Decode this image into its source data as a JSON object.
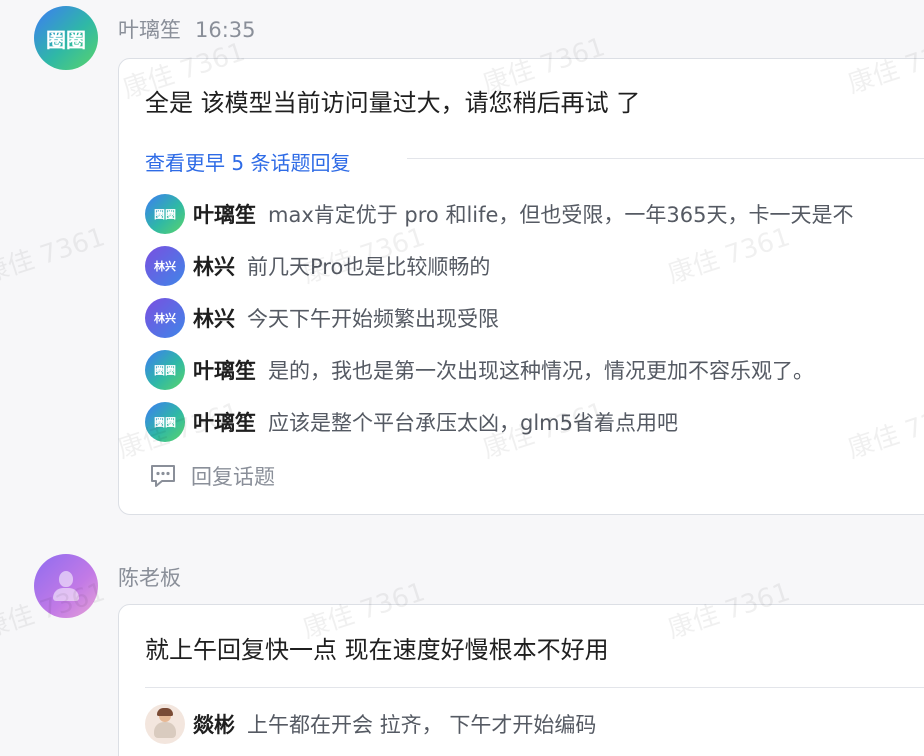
{
  "watermark": "康佳 7361",
  "messages": [
    {
      "author": "叶璃笙",
      "time": "16:35",
      "avatar_text": "圈圈",
      "text": "全是 该模型当前访问量过大，请您稍后再试 了",
      "more_replies": "查看更早 5 条话题回复",
      "replies": [
        {
          "avatar_text": "圈圈",
          "name": "叶璃笙",
          "text": "max肯定优于 pro 和life，但也受限，一年365天，卡一天是不"
        },
        {
          "avatar_text": "林兴",
          "name": "林兴",
          "text": "前几天Pro也是比较顺畅的"
        },
        {
          "avatar_text": "林兴",
          "name": "林兴",
          "text": "今天下午开始频繁出现受限"
        },
        {
          "avatar_text": "圈圈",
          "name": "叶璃笙",
          "text": "是的，我也是第一次出现这种情况，情况更加不容乐观了。"
        },
        {
          "avatar_text": "圈圈",
          "name": "叶璃笙",
          "text": "应该是整个平台承压太凶，glm5省着点用吧"
        }
      ],
      "reply_action": "回复话题"
    },
    {
      "author": "陈老板",
      "text": "就上午回复快一点 现在速度好慢根本不好用",
      "replies": [
        {
          "name": "燚彬",
          "text": "上午都在开会 拉齐， 下午才开始编码"
        }
      ]
    }
  ]
}
